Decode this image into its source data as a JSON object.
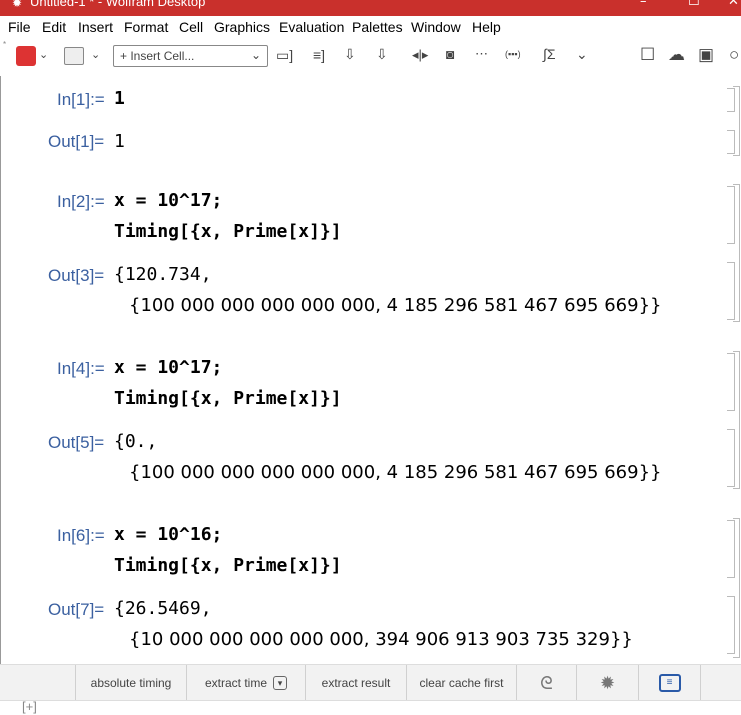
{
  "window": {
    "title": "Untitled-1 * - Wolfram Desktop",
    "minimize": "–",
    "maximize": "☐",
    "close": "✕"
  },
  "menu": {
    "items": [
      "File",
      "Edit",
      "Insert",
      "Format",
      "Cell",
      "Graphics",
      "Evaluation",
      "Palettes",
      "Window",
      "Help"
    ]
  },
  "toolbar": {
    "insert_cell_label": "+ Insert Cell...",
    "dropdown_glyph": "⌄"
  },
  "cells": [
    {
      "in_label": "In[1]:=",
      "input": "1",
      "out_label": "Out[1]=",
      "output_line1": "1"
    },
    {
      "in_label": "In[2]:=",
      "input_line1": "x = 10^17;",
      "input_line2": "Timing[{x, Prime[x]}]",
      "out_label": "Out[3]=",
      "output_line1": "{120.734,",
      "output_line2": "{100 000 000 000 000 000, 4 185 296 581 467 695 669}}"
    },
    {
      "in_label": "In[4]:=",
      "input_line1": "x = 10^17;",
      "input_line2": "Timing[{x, Prime[x]}]",
      "out_label": "Out[5]=",
      "output_line1": "{0.,",
      "output_line2": "{100 000 000 000 000 000, 4 185 296 581 467 695 669}}"
    },
    {
      "in_label": "In[6]:=",
      "input_line1": "x = 10^16;",
      "input_line2": "Timing[{x, Prime[x]}]",
      "out_label": "Out[7]=",
      "output_line1": "{26.5469,",
      "output_line2": "{10 000 000 000 000 000, 394 906 913 903 735 329}}"
    }
  ],
  "suggestions": {
    "absolute_timing": "absolute timing",
    "extract_time": "extract time",
    "extract_result": "extract result",
    "clear_cache_first": "clear cache first"
  },
  "status": {
    "new_cell": "[+]"
  }
}
